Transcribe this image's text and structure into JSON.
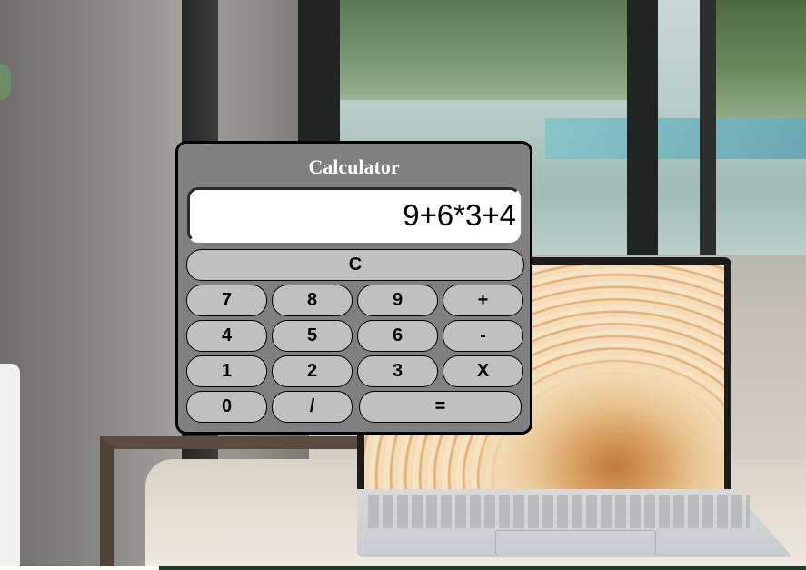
{
  "calculator": {
    "title": "Calculator",
    "display_value": "9+6*3+4",
    "clear_label": "C",
    "keys": {
      "seven": "7",
      "eight": "8",
      "nine": "9",
      "plus": "+",
      "four": "4",
      "five": "5",
      "six": "6",
      "minus": "-",
      "one": "1",
      "two": "2",
      "three": "3",
      "multiply": "X",
      "zero": "0",
      "divide": "/",
      "equals": "="
    },
    "colors": {
      "panel": "#808080",
      "button": "#c0c0c0",
      "border": "#000000",
      "display_bg": "#ffffff",
      "title_text": "#ffffff"
    }
  },
  "background": {
    "description_icons": [
      "wall",
      "window",
      "laptop",
      "chair"
    ]
  }
}
